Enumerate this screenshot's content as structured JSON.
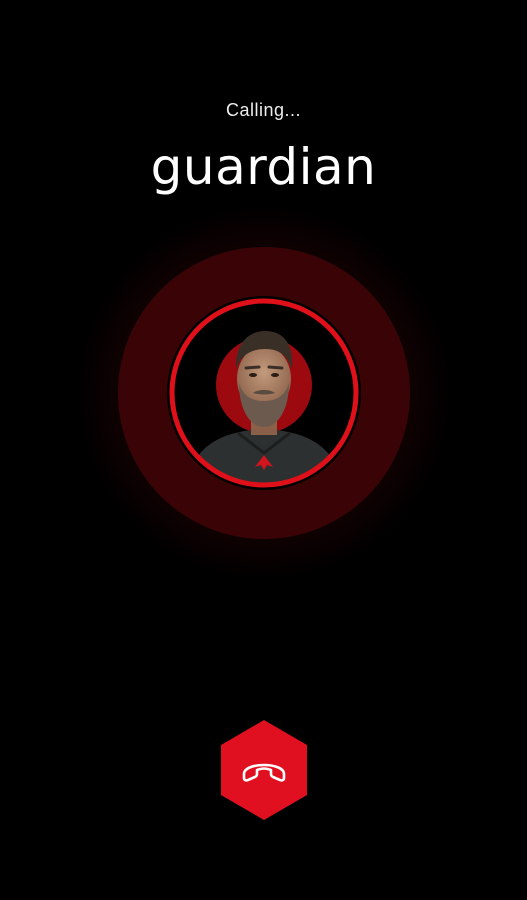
{
  "call": {
    "status_text": "Calling...",
    "caller_name": "guardian"
  },
  "avatar": {
    "icon": "bearded-man-avatar",
    "ring_color": "#e0101a"
  },
  "controls": {
    "end_call": {
      "icon": "hang-up-phone-icon",
      "color": "#e11020"
    }
  },
  "theme": {
    "background": "#000000",
    "accent": "#e0101a",
    "pulse_color": "#3a0406"
  }
}
